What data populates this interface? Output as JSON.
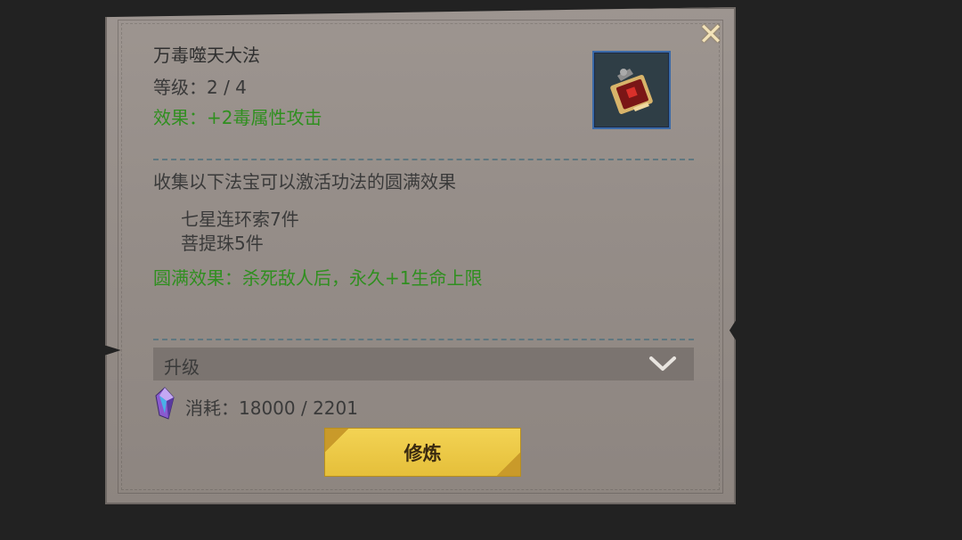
{
  "skill": {
    "name": "万毒噬天大法",
    "level_text": "等级：2 / 4",
    "effect_text": "效果：+2毒属性攻击",
    "icon": "poison-scroll-icon"
  },
  "collection": {
    "description": "收集以下法宝可以激活功法的圆满效果",
    "items": [
      "七星连环索7件",
      "菩提珠5件"
    ],
    "full_effect": "圆满效果：杀死敌人后，永久+1生命上限"
  },
  "upgrade": {
    "label": "升级",
    "cost_text": "消耗：18000 / 2201",
    "cost_icon": "spirit-gem-icon",
    "button_label": "修炼"
  },
  "colors": {
    "effect_green": "#2f8f1f",
    "button_gold": "#e5bf3a"
  }
}
